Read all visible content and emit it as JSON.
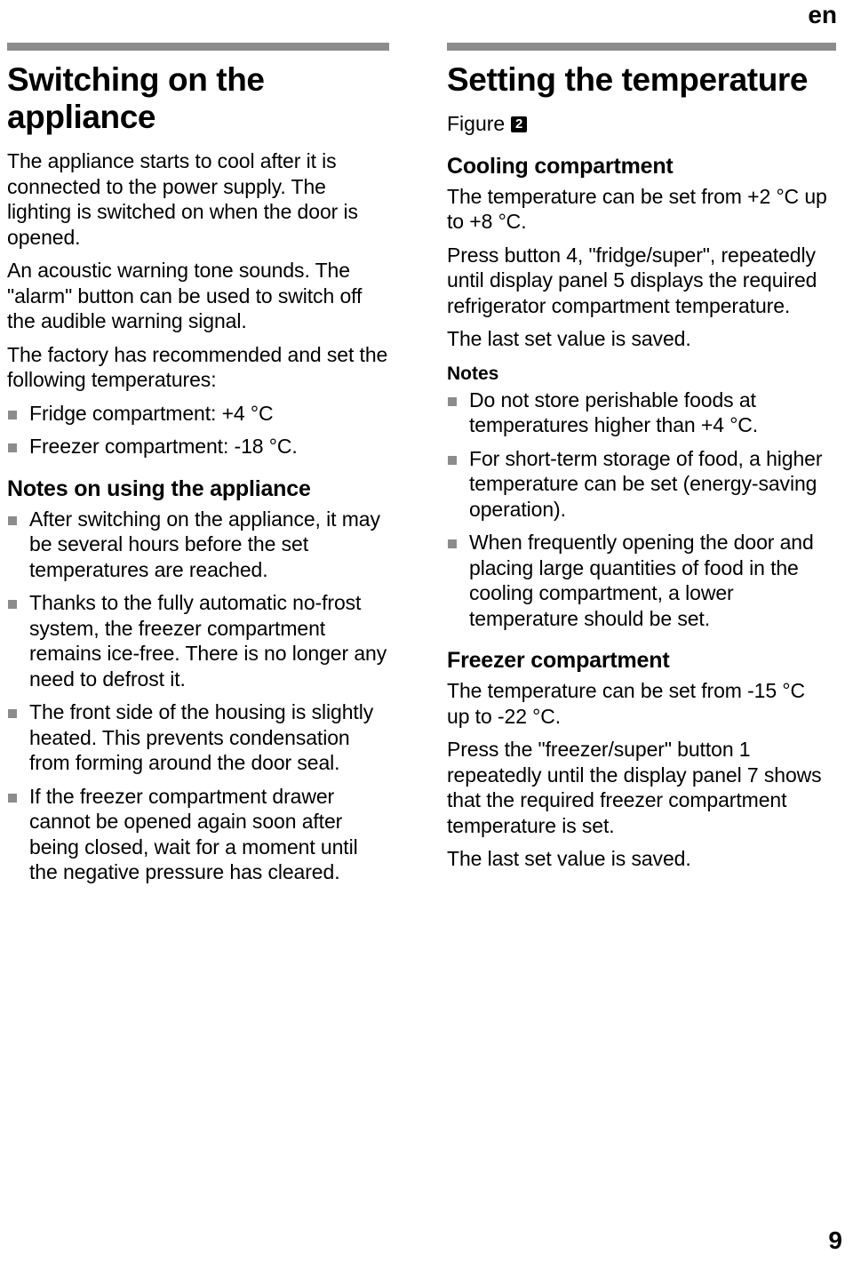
{
  "header": {
    "language_code": "en"
  },
  "footer": {
    "page_number": "9"
  },
  "colors": {
    "rule": "#8c8c8c",
    "bullet": "#8c8c8c",
    "badge_bg": "#000000",
    "badge_fg": "#ffffff",
    "text": "#000000"
  },
  "left_column": {
    "chapter_title": "Switching on the appliance",
    "paragraphs": [
      "The appliance starts to cool after it is connected to the power supply. The lighting is switched on when the door is opened.",
      "An acoustic warning tone sounds. The \"alarm\" button can be used to switch off the audible warning signal.",
      "The factory has recommended and set the following temperatures:"
    ],
    "factory_temperatures": [
      "Fridge compartment: +4 °C",
      "Freezer compartment: -18 °C."
    ],
    "notes_heading": "Notes on using the appliance",
    "notes": [
      "After switching on the appliance, it may be several hours before the set temperatures are reached.",
      "Thanks to the fully automatic no-frost system, the freezer compartment remains ice-free. There is no longer any need to defrost it.",
      "The front side of the housing is slightly heated. This prevents condensation from forming around the door seal.",
      "If the freezer compartment drawer cannot be opened again soon after being closed, wait for a moment until the negative pressure has cleared."
    ]
  },
  "right_column": {
    "chapter_title": "Setting the temperature",
    "figure_label": "Figure",
    "figure_number": "2",
    "cooling": {
      "heading": "Cooling compartment",
      "paragraphs": [
        "The temperature can be set from +2 °C up to +8 °C.",
        "Press button 4, \"fridge/super\", repeatedly until display panel 5 displays the required refrigerator compartment temperature.",
        "The last set value is saved."
      ],
      "notes_heading": "Notes",
      "notes": [
        "Do not store perishable foods at temperatures higher than +4 °C.",
        "For short-term storage of food, a higher temperature can be set (energy-saving operation).",
        "When frequently opening the door and placing large quantities of food in the cooling compartment, a lower temperature should be set."
      ]
    },
    "freezer": {
      "heading": "Freezer compartment",
      "paragraphs": [
        "The temperature can be set from -15 °C up to -22 °C.",
        "Press the \"freezer/super\" button 1 repeatedly until the display panel 7 shows that the required freezer compartment temperature is set.",
        "The last set value is saved."
      ]
    }
  }
}
